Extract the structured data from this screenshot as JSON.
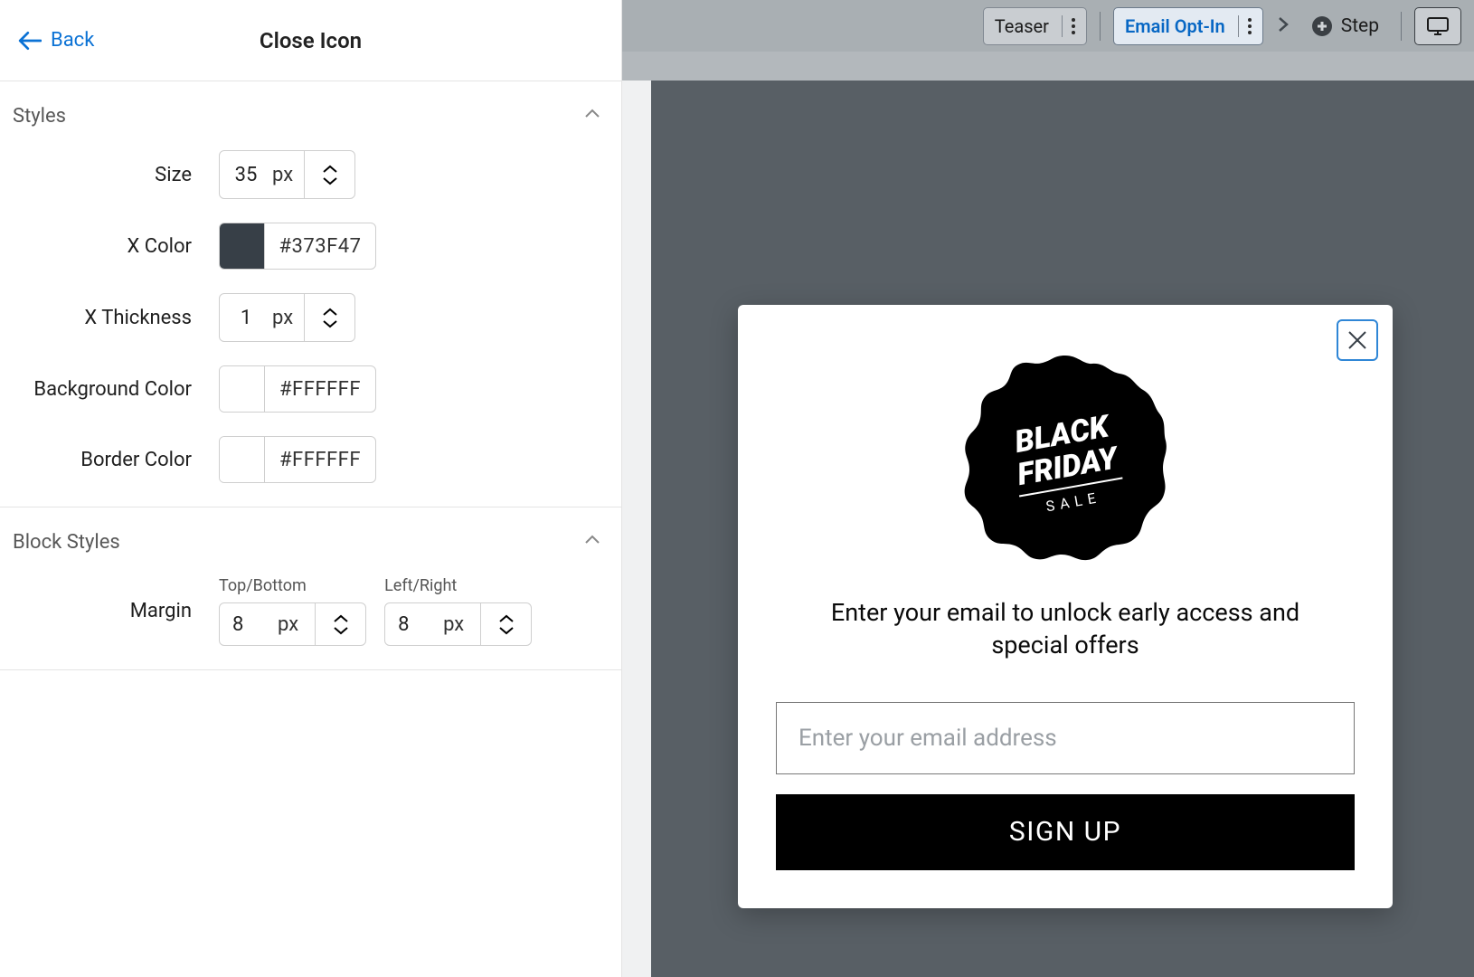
{
  "panel": {
    "back_label": "Back",
    "title": "Close Icon",
    "sections": {
      "styles": {
        "title": "Styles",
        "size": {
          "label": "Size",
          "value": "35",
          "unit": "px"
        },
        "x_color": {
          "label": "X Color",
          "hex": "#373F47",
          "swatch": "#373F47"
        },
        "x_thickness": {
          "label": "X Thickness",
          "value": "1",
          "unit": "px"
        },
        "bg_color": {
          "label": "Background Color",
          "hex": "#FFFFFF",
          "swatch": "#FFFFFF"
        },
        "border_color": {
          "label": "Border Color",
          "hex": "#FFFFFF",
          "swatch": "#FFFFFF"
        }
      },
      "block_styles": {
        "title": "Block Styles",
        "margin_label": "Margin",
        "margin_tb": {
          "label": "Top/Bottom",
          "value": "8",
          "unit": "px"
        },
        "margin_lr": {
          "label": "Left/Right",
          "value": "8",
          "unit": "px"
        }
      }
    }
  },
  "topbar": {
    "teaser": "Teaser",
    "email_opt_in": "Email Opt-In",
    "step": "Step"
  },
  "popup": {
    "badge_line1": "BLACK",
    "badge_line2": "FRIDAY",
    "badge_sub": "SALE",
    "message": "Enter your email to unlock early access and special offers",
    "email_placeholder": "Enter your email address",
    "cta": "SIGN UP"
  }
}
